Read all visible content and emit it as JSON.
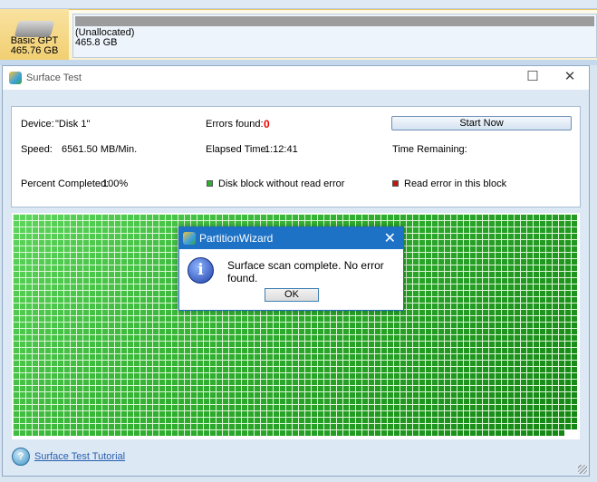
{
  "disk": {
    "type": "Basic GPT",
    "size": "465.76 GB",
    "partition_label": "(Unallocated)",
    "partition_size": "465.8 GB"
  },
  "window": {
    "title": "Surface Test"
  },
  "info": {
    "device_label": "Device:",
    "device_value": "\"Disk 1\"",
    "errors_label": "Errors found:",
    "errors_value": "0",
    "start_button": "Start Now",
    "speed_label": "Speed:",
    "speed_value": "6561.50 MB/Min.",
    "elapsed_label": "Elapsed Time:",
    "elapsed_value": "1:12:41",
    "remaining_label": "Time Remaining:",
    "percent_label": "Percent Completed:",
    "percent_value": "100%",
    "legend_ok": "Disk block without read error",
    "legend_err": "Read error in this block",
    "colors": {
      "ok": "#2fae2f",
      "error": "#c0180c"
    }
  },
  "footer": {
    "tutorial_link": "Surface Test Tutorial"
  },
  "message_box": {
    "title": "PartitionWizard",
    "text": "Surface scan complete. No error found.",
    "ok_button": "OK",
    "icon": "info-icon"
  }
}
